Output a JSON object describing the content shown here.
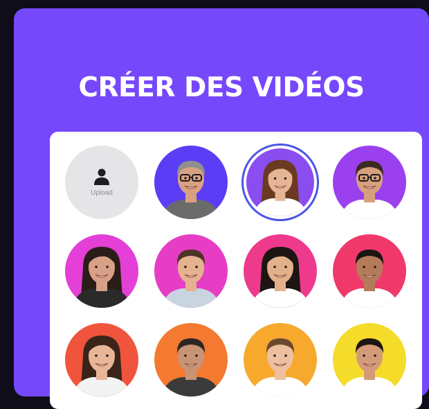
{
  "card": {
    "title": "CRÉER DES VIDÉOS",
    "background": "#7648fb"
  },
  "upload": {
    "label": "Upload",
    "icon": "person-icon"
  },
  "avatars": [
    {
      "name": "avatar-older-man-glasses",
      "bg": "#5b3df5",
      "skin": "#d9a182",
      "hair": "#8f8f8f",
      "shirt": "#6b6b6b",
      "glasses": true,
      "hair_style": "short",
      "selected": false
    },
    {
      "name": "avatar-woman-brown-hair",
      "bg": "#8a4df0",
      "skin": "#e6b595",
      "hair": "#6b3a22",
      "shirt": "#ffffff",
      "glasses": false,
      "hair_style": "long",
      "selected": true
    },
    {
      "name": "avatar-man-glasses-beard",
      "bg": "#9b40ee",
      "skin": "#d79f7e",
      "hair": "#3a2a20",
      "shirt": "#ffffff",
      "glasses": true,
      "hair_style": "short",
      "selected": false
    },
    {
      "name": "avatar-woman-dark-hair",
      "bg": "#e43fd6",
      "skin": "#d9a088",
      "hair": "#2a1d18",
      "shirt": "#2a2a2a",
      "glasses": false,
      "hair_style": "long",
      "selected": false
    },
    {
      "name": "avatar-man-short-hair",
      "bg": "#e63dc4",
      "skin": "#e5b191",
      "hair": "#4b3424",
      "shirt": "#c8d4e0",
      "glasses": false,
      "hair_style": "short",
      "selected": false
    },
    {
      "name": "avatar-asian-woman",
      "bg": "#ee3a8c",
      "skin": "#e2b08a",
      "hair": "#1c1512",
      "shirt": "#ffffff",
      "glasses": false,
      "hair_style": "long",
      "selected": false
    },
    {
      "name": "avatar-bearded-man",
      "bg": "#f0396a",
      "skin": "#b47b5a",
      "hair": "#1a1412",
      "shirt": "#ffffff",
      "glasses": false,
      "hair_style": "short",
      "selected": false
    },
    {
      "name": "avatar-smiling-woman",
      "bg": "#f0543c",
      "skin": "#e8b697",
      "hair": "#3a2418",
      "shirt": "#f3f3f3",
      "glasses": false,
      "hair_style": "long",
      "selected": false
    },
    {
      "name": "avatar-older-man-beard",
      "bg": "#f47a32",
      "skin": "#c99376",
      "hair": "#2e2622",
      "shirt": "#3a3a3a",
      "glasses": false,
      "hair_style": "short",
      "selected": false
    },
    {
      "name": "avatar-blonde-woman",
      "bg": "#f7a92e",
      "skin": "#edc0a0",
      "hair": "#6a4a2e",
      "shirt": "#ffffff",
      "glasses": false,
      "hair_style": "short",
      "selected": false
    },
    {
      "name": "avatar-smiling-man-beard",
      "bg": "#f5dc2a",
      "skin": "#d49b78",
      "hair": "#1e1612",
      "shirt": "#ffffff",
      "glasses": false,
      "hair_style": "short",
      "selected": false
    }
  ]
}
